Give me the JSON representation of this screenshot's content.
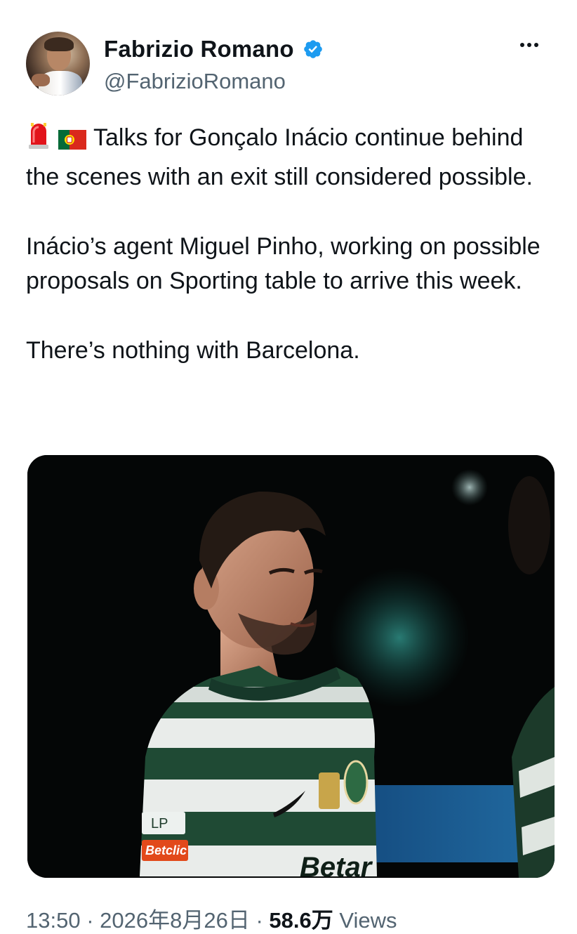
{
  "author": {
    "display_name": "Fabrizio Romano",
    "handle": "@FabrizioRomano",
    "verified": true,
    "verified_color": "#1d9bf0",
    "avatar_icon": "profile-photo"
  },
  "menu": {
    "more_icon": "ellipsis-icon"
  },
  "tweet": {
    "emojis": [
      "rotating-light-emoji",
      "portugal-flag-emoji"
    ],
    "paragraph_1": "Talks for Gonçalo Inácio continue behind the scenes with an exit still considered possible.",
    "paragraph_2": "Inácio’s agent Miguel Pinho, working on possible proposals on Sporting table to arrive this week.",
    "paragraph_3": "There’s nothing with Barcelona."
  },
  "media": {
    "kind": "photo",
    "shirt_text": "Betclic",
    "shirt_sponsor_partial": "Betar",
    "sleeve_badge": "LP"
  },
  "meta": {
    "time": "13:50",
    "separator_1": "·",
    "date": "2026年8月26日",
    "separator_2": "·",
    "views_count": "58.6万",
    "views_label": "Views"
  }
}
